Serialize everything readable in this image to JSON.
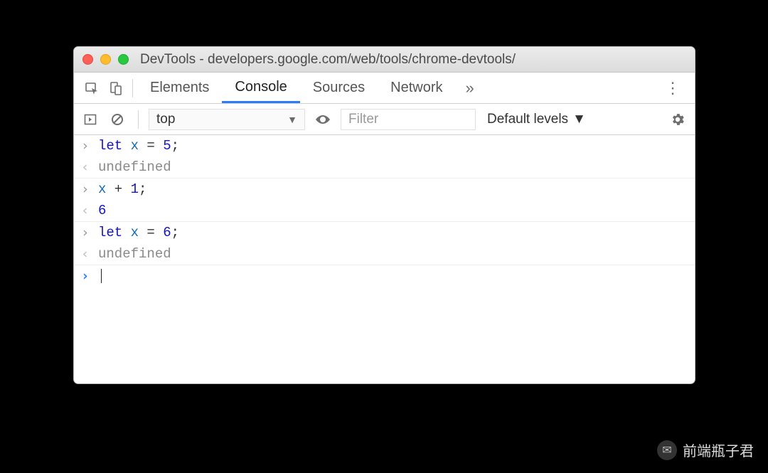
{
  "window": {
    "title": "DevTools - developers.google.com/web/tools/chrome-devtools/"
  },
  "tabs": {
    "items": [
      "Elements",
      "Console",
      "Sources",
      "Network"
    ],
    "active_index": 1,
    "overflow_glyph": "»"
  },
  "toolbar": {
    "context": "top",
    "filter_placeholder": "Filter",
    "levels_label": "Default levels"
  },
  "console": {
    "entries": [
      {
        "type": "input",
        "tokens": [
          [
            "kw",
            "let "
          ],
          [
            "var",
            "x"
          ],
          [
            "op",
            " = "
          ],
          [
            "num",
            "5"
          ],
          [
            "op",
            ";"
          ]
        ]
      },
      {
        "type": "output",
        "kind": "undef",
        "text": "undefined"
      },
      {
        "type": "input",
        "tokens": [
          [
            "var",
            "x"
          ],
          [
            "op",
            " + "
          ],
          [
            "num",
            "1"
          ],
          [
            "op",
            ";"
          ]
        ]
      },
      {
        "type": "output",
        "kind": "num",
        "text": "6"
      },
      {
        "type": "input",
        "tokens": [
          [
            "kw",
            "let "
          ],
          [
            "var",
            "x"
          ],
          [
            "op",
            " = "
          ],
          [
            "num",
            "6"
          ],
          [
            "op",
            ";"
          ]
        ]
      },
      {
        "type": "output",
        "kind": "undef",
        "text": "undefined"
      }
    ],
    "prompt_glyph": "›",
    "input_glyph": "›",
    "output_glyph": "‹"
  },
  "watermark": {
    "text": "前端瓶子君"
  }
}
